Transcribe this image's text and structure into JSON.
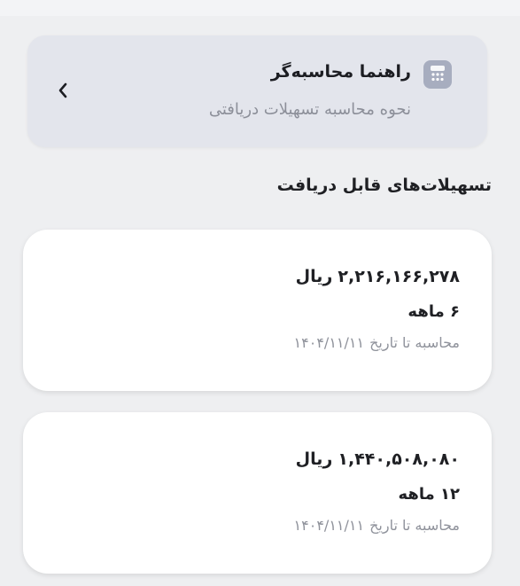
{
  "guide": {
    "title": "راهنما محاسبه‌گر",
    "subtitle": "نحوه محاسبه تسهیلات دریافتی",
    "icon": "calculator-icon",
    "chevron_icon": "chevron-left-icon"
  },
  "section": {
    "title": "تسهیلات‌های قابل دریافت"
  },
  "facilities": [
    {
      "amount": "۲,۲۱۶,۱۶۶,۲۷۸",
      "currency": "ریال",
      "duration": "۶ ماهه",
      "date_label": "محاسبه تا تاریخ",
      "date": "۱۴۰۴/۱۱/۱۱"
    },
    {
      "amount": "۱,۴۴۰,۵۰۸,۰۸۰",
      "currency": "ریال",
      "duration": "۱۲ ماهه",
      "date_label": "محاسبه تا تاریخ",
      "date": "۱۴۰۴/۱۱/۱۱"
    }
  ],
  "colors": {
    "background": "#eeeff1",
    "guide_card": "#e3e5ec",
    "icon_bg": "#a7adbf",
    "text_primary": "#1f2024",
    "text_secondary": "#8c8f99"
  }
}
